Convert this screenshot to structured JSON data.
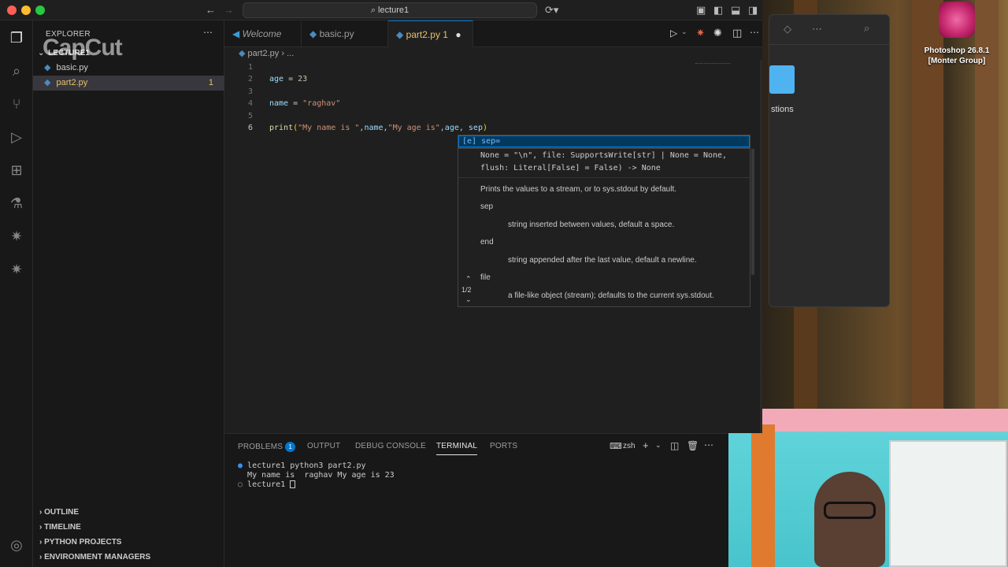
{
  "window": {
    "title": "lecture1"
  },
  "tabs": [
    {
      "label": "Welcome",
      "icon": "vscode-icon"
    },
    {
      "label": "basic.py",
      "icon": "python-icon"
    },
    {
      "label": "part2.py",
      "icon": "python-icon",
      "badge": "1",
      "modified": true
    }
  ],
  "watermark": "CapCut",
  "sidebar": {
    "header": "EXPLORER",
    "folder": "LECTURE1",
    "files": [
      {
        "name": "basic.py"
      },
      {
        "name": "part2.py",
        "problems": "1"
      }
    ],
    "sections": [
      "OUTLINE",
      "TIMELINE",
      "PYTHON PROJECTS",
      "ENVIRONMENT MANAGERS"
    ]
  },
  "breadcrumb": {
    "file": "part2.py",
    "rest": "..."
  },
  "editor": {
    "line_numbers": [
      "1",
      "2",
      "3",
      "4",
      "5",
      "6"
    ],
    "line2": {
      "var": "age",
      "op": " = ",
      "val": "23"
    },
    "line4": {
      "var": "name",
      "op": " = ",
      "val": "\"raghav\""
    },
    "line6": {
      "fn": "print",
      "open": "(",
      "s1": "\"My name is \"",
      "mid1": ",name,",
      "s2": "\"My age is\"",
      "mid2": ",age, sep",
      "close": ")"
    }
  },
  "suggest": {
    "icon": "[e]",
    "item": "sep="
  },
  "signature_help": {
    "sig1": "None = \"\\n\", file: SupportsWrite[str] | None = None,",
    "sig2": "flush: Literal[False] = False) -> None",
    "desc": "Prints the values to a stream, or to sys.stdout by default.",
    "p1": "sep",
    "p1d": "string inserted between values, default a space.",
    "p2": "end",
    "p2d": "string appended after the last value, default a newline.",
    "p3": "file",
    "p3d": "a file-like object (stream); defaults to the current sys.stdout.",
    "pager": "1/2"
  },
  "panel": {
    "tabs": [
      "PROBLEMS",
      "OUTPUT",
      "DEBUG CONSOLE",
      "TERMINAL",
      "PORTS"
    ],
    "problems_count": "1",
    "shell": "zsh",
    "terminal": [
      "lecture1 python3 part2.py",
      "My name is  raghav My age is 23",
      "lecture1 "
    ]
  },
  "desktop": {
    "ps_label_1": "Photoshop 26.8.1",
    "ps_label_2": "[Monter Group]",
    "finder_text": "stions"
  },
  "colors": {
    "accent": "#0078d4",
    "modified_tab": "#e8c06a",
    "background": "#1f1f1f"
  }
}
